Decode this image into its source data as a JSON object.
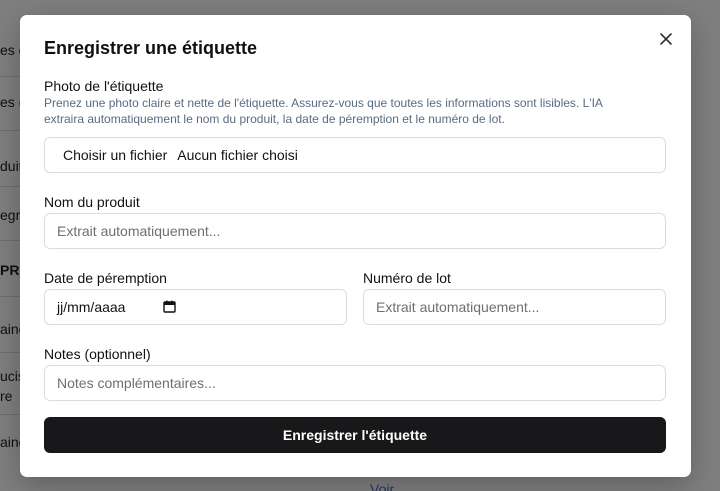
{
  "background": {
    "rows": [
      "es é",
      "es (",
      "duit",
      "egre",
      "PRÈ",
      "aine",
      "ucis",
      "re",
      "aine"
    ],
    "link": "Voir"
  },
  "modal": {
    "title": "Enregistrer une étiquette",
    "photo": {
      "label": "Photo de l'étiquette",
      "help": "Prenez une photo claire et nette de l'étiquette. Assurez-vous que toutes les informations sont lisibles. L'IA extraira automatiquement le nom du produit, la date de péremption et le numéro de lot.",
      "choose_button": "Choisir un fichier",
      "status": "Aucun fichier choisi"
    },
    "product_name": {
      "label": "Nom du produit",
      "placeholder": "Extrait automatiquement..."
    },
    "expiry_date": {
      "label": "Date de péremption",
      "value": "jj/mm/aaaa"
    },
    "lot_number": {
      "label": "Numéro de lot",
      "placeholder": "Extrait automatiquement..."
    },
    "notes": {
      "label": "Notes (optionnel)",
      "placeholder": "Notes complémentaires..."
    },
    "submit_label": "Enregistrer l'étiquette"
  }
}
